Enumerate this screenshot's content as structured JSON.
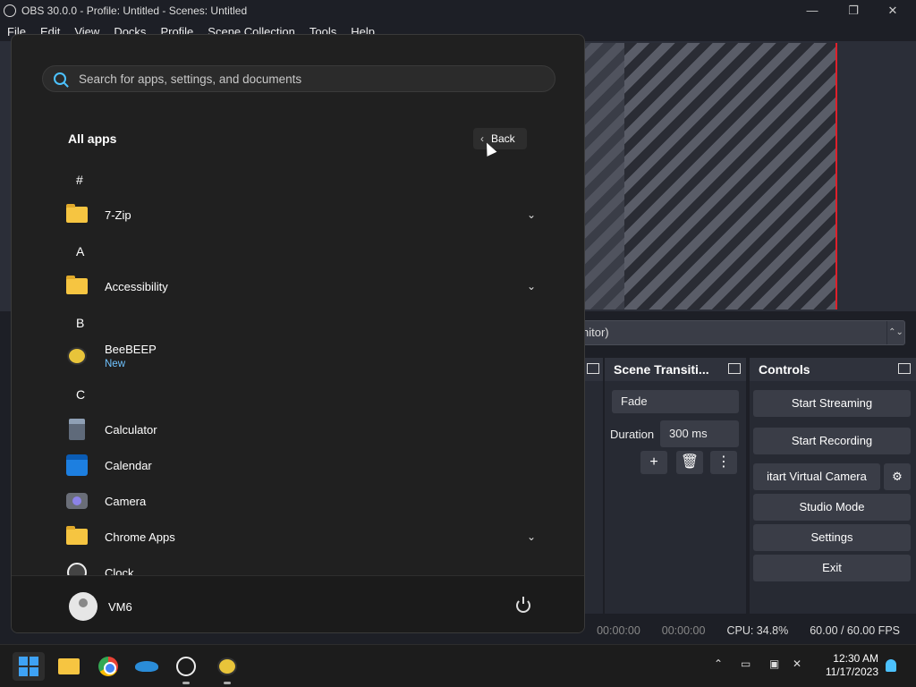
{
  "obs": {
    "window_title": "OBS 30.0.0 - Profile: Untitled - Scenes: Untitled",
    "menu": [
      "File",
      "Edit",
      "View",
      "Docks",
      "Profile",
      "Scene Collection",
      "Tools",
      "Help"
    ],
    "monitor_select_value": "nitor)",
    "scene_transitions": {
      "title": "Scene Transiti...",
      "transition": "Fade",
      "duration_label": "Duration",
      "duration_value": "300 ms"
    },
    "controls": {
      "title": "Controls",
      "start_streaming": "Start Streaming",
      "start_recording": "Start Recording",
      "start_virtual_camera": "itart Virtual Camera",
      "studio_mode": "Studio Mode",
      "settings": "Settings",
      "exit": "Exit"
    },
    "status": {
      "stream_time": "00:00:00",
      "record_time": "00:00:00",
      "cpu": "CPU: 34.8%",
      "fps": "60.00 / 60.00 FPS"
    }
  },
  "start_menu": {
    "search_placeholder": "Search for apps, settings, and documents",
    "section_title": "All apps",
    "back_label": "Back",
    "letters": [
      "#",
      "A",
      "B",
      "C"
    ],
    "apps": [
      {
        "name": "7-Zip",
        "icon": "folder-icon",
        "expandable": true
      },
      {
        "name": "Accessibility",
        "icon": "folder-icon",
        "expandable": true
      },
      {
        "name": "BeeBEEP",
        "icon": "bee-icon",
        "badge": "New"
      },
      {
        "name": "Calculator",
        "icon": "calculator-icon"
      },
      {
        "name": "Calendar",
        "icon": "calendar-icon"
      },
      {
        "name": "Camera",
        "icon": "camera-icon"
      },
      {
        "name": "Chrome Apps",
        "icon": "folder-icon",
        "expandable": true
      },
      {
        "name": "Clock",
        "icon": "clock-icon"
      }
    ],
    "user_name": "VM6"
  },
  "taskbar": {
    "time": "12:30 AM",
    "date": "11/17/2023"
  }
}
